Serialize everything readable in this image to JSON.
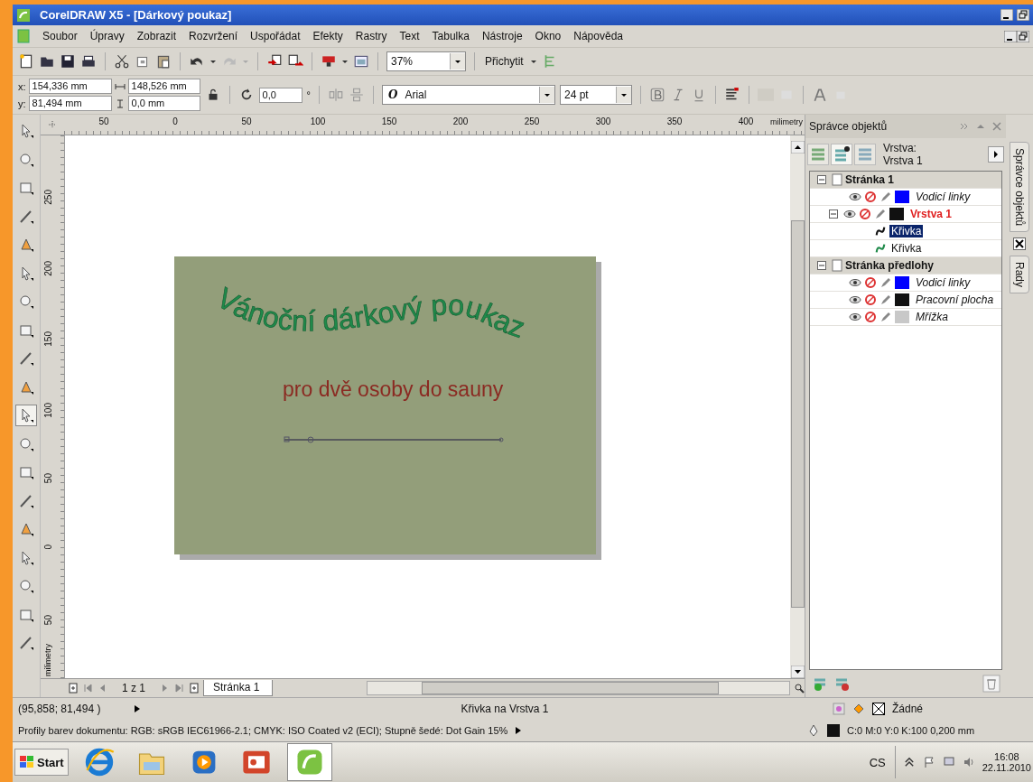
{
  "window": {
    "title": "CorelDRAW X5 - [Dárkový poukaz]"
  },
  "menu": [
    "Soubor",
    "Úpravy",
    "Zobrazit",
    "Rozvržení",
    "Uspořádat",
    "Efekty",
    "Rastry",
    "Text",
    "Tabulka",
    "Nástroje",
    "Okno",
    "Nápověda"
  ],
  "toolbar": {
    "zoom": "37%",
    "snap": "Přichytit"
  },
  "property_bar": {
    "x_label": "x:",
    "y_label": "y:",
    "font_type": "O",
    "x": "154,336 mm",
    "y": "81,494 mm",
    "width": "148,526 mm",
    "height": "0,0 mm",
    "rotation": "0,0",
    "degree": "°",
    "font": "Arial",
    "font_size": "24 pt"
  },
  "toolbox": [
    {
      "selected": false
    },
    {
      "selected": false
    },
    {
      "selected": false
    },
    {
      "selected": false
    },
    {
      "selected": false
    },
    {
      "selected": false
    },
    {
      "selected": false
    },
    {
      "selected": false
    },
    {
      "selected": false
    },
    {
      "selected": false
    },
    {
      "selected": true
    },
    {
      "selected": false
    },
    {
      "selected": false
    },
    {
      "selected": false
    },
    {
      "selected": false
    },
    {
      "selected": false
    },
    {
      "selected": false
    },
    {
      "selected": false
    },
    {
      "selected": false
    }
  ],
  "rulers": {
    "horizontal": [
      "50",
      "0",
      "50",
      "100",
      "150",
      "200",
      "250",
      "300",
      "350",
      "400"
    ],
    "horizontal_unit": "milimetry",
    "vertical": [
      "250",
      "200",
      "150",
      "100",
      "50",
      "0",
      "50"
    ],
    "vertical_unit": "milimetry"
  },
  "document": {
    "title": "Vánoční dárkový poukaz",
    "subtitle": "pro dvě osoby do sauny"
  },
  "page_nav": {
    "count": "1 z 1",
    "tab": "Stránka 1"
  },
  "docker": {
    "title": "Správce objektů",
    "layer_label": "Vrstva:",
    "layer_name": "Vrstva 1",
    "tree": [
      {
        "kind": "page",
        "label": "Stránka 1",
        "expanded": true,
        "children": [
          {
            "kind": "layer",
            "label": "Vodicí linky",
            "color": "#0000ff",
            "active": false
          },
          {
            "kind": "layer",
            "label": "Vrstva 1",
            "color": "#111111",
            "active": true,
            "expanded": true,
            "children": [
              {
                "kind": "object",
                "label": "Křivka",
                "color": "#111111",
                "selected": true
              },
              {
                "kind": "object",
                "label": "Křivka",
                "color": "#1f8a4a",
                "selected": false
              }
            ]
          }
        ]
      },
      {
        "kind": "page",
        "label": "Stránka předlohy",
        "expanded": true,
        "children": [
          {
            "kind": "layer",
            "label": "Vodicí linky",
            "color": "#0000ff",
            "active": false
          },
          {
            "kind": "layer",
            "label": "Pracovní plocha",
            "color": "#111111",
            "active": false
          },
          {
            "kind": "layer",
            "label": "Mřížka",
            "color": "#c8c8c8",
            "active": false
          }
        ]
      }
    ],
    "side_tabs": [
      "Správce objektů",
      "Rady"
    ]
  },
  "status": {
    "coords": "(95,858; 81,494 )",
    "selection": "Křivka na Vrstva 1",
    "fill": "Žádné",
    "profiles": "Profily barev dokumentu: RGB: sRGB IEC61966-2.1; CMYK: ISO Coated v2 (ECI); Stupně šedé: Dot Gain 15%",
    "outline": "C:0 M:0 Y:0 K:100  0,200 mm"
  },
  "taskbar": {
    "start": "Start",
    "language": "CS",
    "time": "16:08",
    "date": "22.11.2010"
  }
}
